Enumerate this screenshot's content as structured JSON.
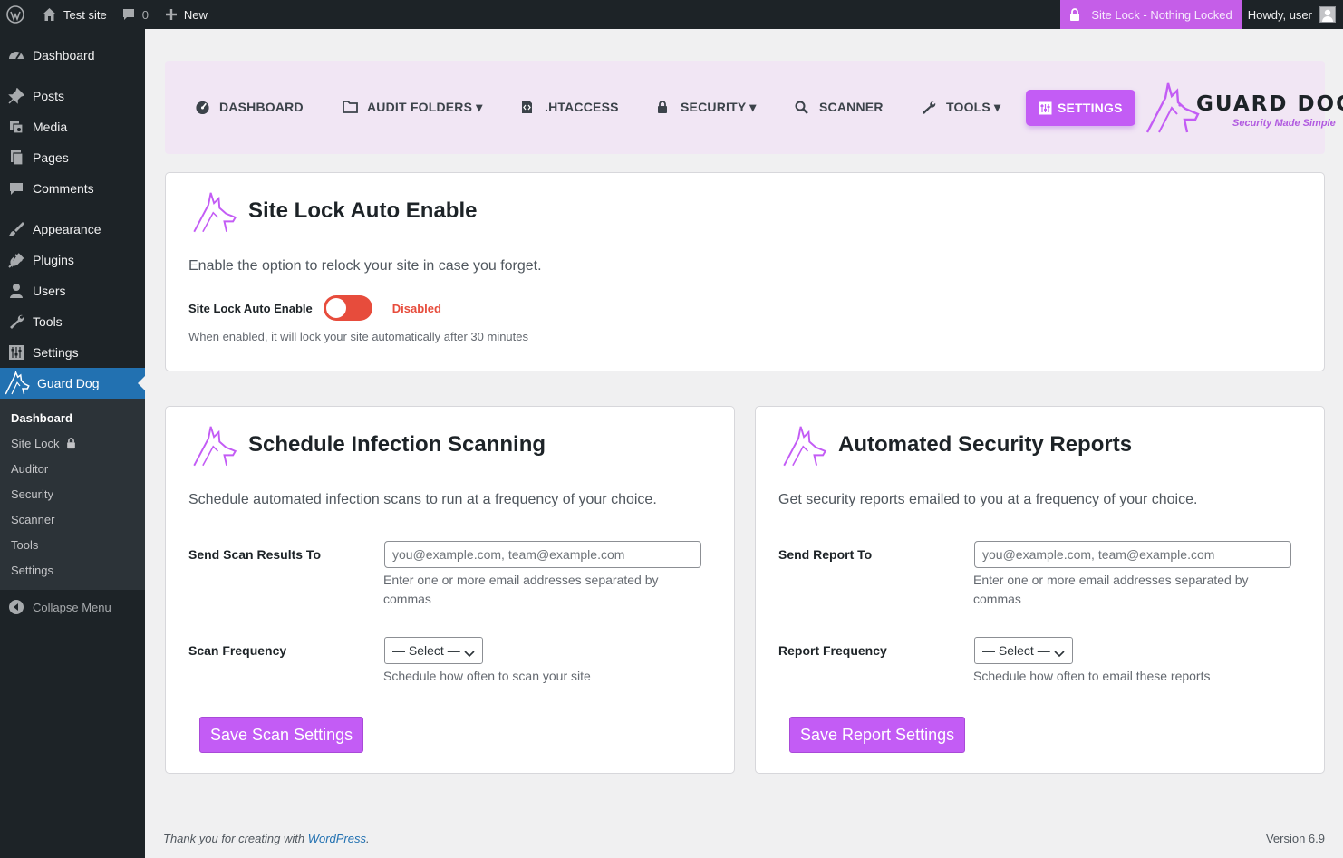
{
  "adminbar": {
    "site_name": "Test site",
    "comments_count": "0",
    "new_label": "New",
    "site_lock_label": "Site Lock - Nothing Locked",
    "howdy": "Howdy, user"
  },
  "sidebar": {
    "items": [
      {
        "label": "Dashboard",
        "icon": "dashboard-icon"
      },
      {
        "label": "Posts",
        "icon": "pin-icon"
      },
      {
        "label": "Media",
        "icon": "media-icon"
      },
      {
        "label": "Pages",
        "icon": "pages-icon"
      },
      {
        "label": "Comments",
        "icon": "comment-icon"
      },
      {
        "label": "Appearance",
        "icon": "brush-icon"
      },
      {
        "label": "Plugins",
        "icon": "plug-icon"
      },
      {
        "label": "Users",
        "icon": "user-icon"
      },
      {
        "label": "Tools",
        "icon": "wrench-icon"
      },
      {
        "label": "Settings",
        "icon": "sliders-icon"
      },
      {
        "label": "Guard Dog",
        "icon": "guard-dog-icon"
      }
    ],
    "submenu": [
      "Dashboard",
      "Site Lock",
      "Auditor",
      "Security",
      "Scanner",
      "Tools",
      "Settings"
    ],
    "collapse_label": "Collapse Menu"
  },
  "nav": {
    "items": [
      "DASHBOARD",
      "AUDIT FOLDERS ▾",
      ".HTACCESS",
      "SECURITY ▾",
      "SCANNER",
      "TOOLS ▾",
      "SETTINGS"
    ],
    "active": "SETTINGS",
    "accent": "#c35cf5"
  },
  "logo": {
    "brand": "GUARD DOG",
    "tagline": "Security Made Simple"
  },
  "site_lock_card": {
    "title": "Site Lock Auto Enable",
    "description": "Enable the option to relock your site in case you forget.",
    "field_label": "Site Lock Auto Enable",
    "status": "Disabled",
    "status_color": "#e74c3c",
    "help": "When enabled, it will lock your site automatically after 30 minutes"
  },
  "scan_card": {
    "title": "Schedule Infection Scanning",
    "description": "Schedule automated infection scans to run at a frequency of your choice.",
    "email_label": "Send Scan Results To",
    "email_placeholder": "you@example.com, team@example.com",
    "email_help": "Enter one or more email addresses separated by commas",
    "frequency_label": "Scan Frequency",
    "frequency_value": "— Select —",
    "frequency_help": "Schedule how often to scan your site",
    "save_label": "Save Scan Settings"
  },
  "report_card": {
    "title": "Automated Security Reports",
    "description": "Get security reports emailed to you at a frequency of your choice.",
    "email_label": "Send Report To",
    "email_placeholder": "you@example.com, team@example.com",
    "email_help": "Enter one or more email addresses separated by commas",
    "frequency_label": "Report Frequency",
    "frequency_value": "— Select —",
    "frequency_help": "Schedule how often to email these reports",
    "save_label": "Save Report Settings"
  },
  "footer": {
    "thanks_prefix": "Thank you for creating with ",
    "wordpress_link": "WordPress",
    "thanks_suffix": ".",
    "version": "Version 6.9"
  }
}
